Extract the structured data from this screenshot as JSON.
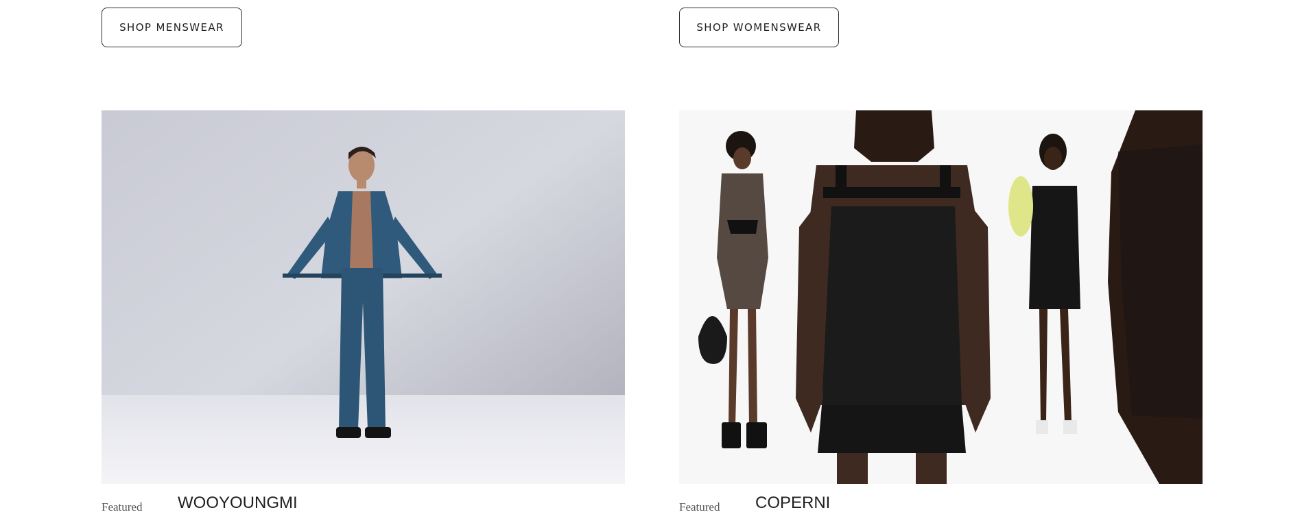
{
  "menswear": {
    "button_label": "SHOP MENSWEAR",
    "image_alt": "Model in denim jacket and jeans",
    "caption_label": "Featured",
    "brand": "WOOYOUNGMI"
  },
  "womenswear": {
    "button_label": "SHOP WOMENSWEAR",
    "image_alt": "Models in black dresses",
    "caption_label": "Featured",
    "brand": "COPERNI"
  },
  "colors": {
    "button_border": "#2b2b2b",
    "text": "#1f1f1f",
    "denim": "#2f5a7c"
  }
}
